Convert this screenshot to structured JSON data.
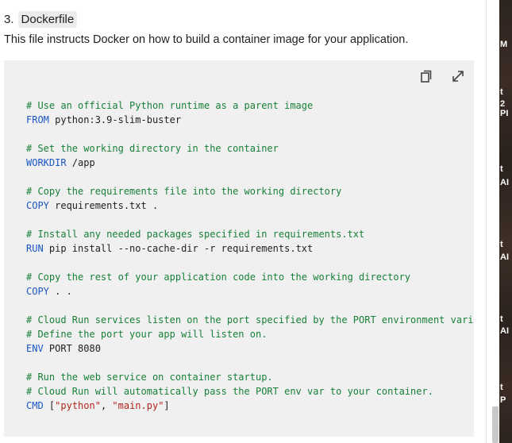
{
  "section": {
    "number": "3.",
    "title": "Dockerfile",
    "description": "This file instructs Docker on how to build a container image for your application."
  },
  "toolbar": {
    "copy_icon": "copy-icon",
    "expand_icon": "expand-icon"
  },
  "code_lines": [
    [
      {
        "t": "cm",
        "v": "# Use an official Python runtime as a parent image"
      }
    ],
    [
      {
        "t": "kw",
        "v": "FROM"
      },
      {
        "t": "tx",
        "v": " python:3.9-slim-buster"
      }
    ],
    [],
    [
      {
        "t": "cm",
        "v": "# Set the working directory in the container"
      }
    ],
    [
      {
        "t": "kw",
        "v": "WORKDIR"
      },
      {
        "t": "tx",
        "v": " /app"
      }
    ],
    [],
    [
      {
        "t": "cm",
        "v": "# Copy the requirements file into the working directory"
      }
    ],
    [
      {
        "t": "kw",
        "v": "COPY"
      },
      {
        "t": "tx",
        "v": " requirements.txt ."
      }
    ],
    [],
    [
      {
        "t": "cm",
        "v": "# Install any needed packages specified in requirements.txt"
      }
    ],
    [
      {
        "t": "kw",
        "v": "RUN"
      },
      {
        "t": "tx",
        "v": " pip install --no-cache-dir -r requirements.txt"
      }
    ],
    [],
    [
      {
        "t": "cm",
        "v": "# Copy the rest of your application code into the working directory"
      }
    ],
    [
      {
        "t": "kw",
        "v": "COPY"
      },
      {
        "t": "tx",
        "v": " . ."
      }
    ],
    [],
    [
      {
        "t": "cm",
        "v": "# Cloud Run services listen on the port specified by the PORT environment vari"
      }
    ],
    [
      {
        "t": "cm",
        "v": "# Define the port your app will listen on."
      }
    ],
    [
      {
        "t": "kw",
        "v": "ENV"
      },
      {
        "t": "tx",
        "v": " PORT 8080"
      }
    ],
    [],
    [
      {
        "t": "cm",
        "v": "# Run the web service on container startup."
      }
    ],
    [
      {
        "t": "cm",
        "v": "# Cloud Run will automatically pass the PORT env var to your container."
      }
    ],
    [
      {
        "t": "kw",
        "v": "CMD"
      },
      {
        "t": "tx",
        "v": " ["
      },
      {
        "t": "st",
        "v": "\"python\""
      },
      {
        "t": "tx",
        "v": ", "
      },
      {
        "t": "st",
        "v": "\"main.py\""
      },
      {
        "t": "tx",
        "v": "]"
      }
    ]
  ],
  "right_panel": {
    "fragments": [
      "M",
      "t",
      "2 PI",
      "t",
      "AI",
      "t",
      "AI",
      "t",
      "AI",
      "t",
      "P"
    ]
  },
  "colors": {
    "comment": "#188038",
    "keyword": "#1a57c4",
    "string": "#b3261e",
    "code_background": "#f0f0f0"
  }
}
